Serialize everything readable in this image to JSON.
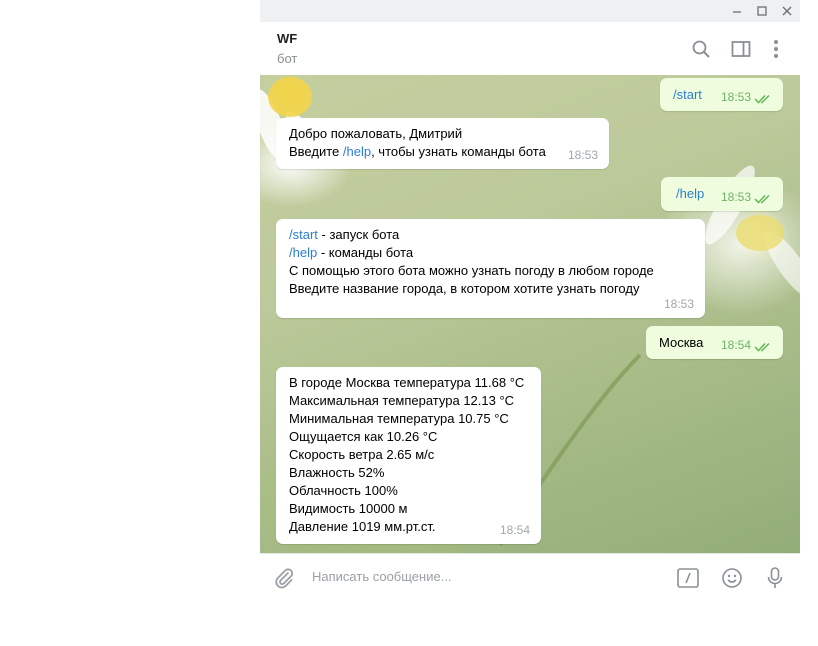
{
  "window": {
    "title": "",
    "minimize": "—",
    "maximize": "□",
    "close": "✕"
  },
  "header": {
    "title": "WF",
    "subtitle": "бот",
    "icons": [
      "search-icon",
      "sidebar-toggle-icon",
      "more-icon"
    ]
  },
  "messages": [
    {
      "dir": "out",
      "parts": [
        {
          "text": "/start",
          "cmd": true
        }
      ],
      "time": "18:53",
      "status": "read"
    },
    {
      "dir": "in",
      "lines": [
        [
          {
            "text": "Добро пожаловать, Дмитрий"
          }
        ],
        [
          {
            "text": "Введите "
          },
          {
            "text": "/help",
            "cmd": true
          },
          {
            "text": ", чтобы узнать команды бота"
          }
        ]
      ],
      "time": "18:53"
    },
    {
      "dir": "out",
      "parts": [
        {
          "text": "/help",
          "cmd": true
        }
      ],
      "time": "18:53",
      "status": "read"
    },
    {
      "dir": "in",
      "lines": [
        [
          {
            "text": "/start",
            "cmd": true
          },
          {
            "text": " - запуск бота"
          }
        ],
        [
          {
            "text": "/help",
            "cmd": true
          },
          {
            "text": " - команды бота"
          }
        ],
        [
          {
            "text": "С помощью этого бота можно узнать погоду в любом городе"
          }
        ],
        [
          {
            "text": "Введите название города, в котором хотите узнать погоду"
          }
        ]
      ],
      "time": "18:53"
    },
    {
      "dir": "out",
      "parts": [
        {
          "text": "Москва"
        }
      ],
      "time": "18:54",
      "status": "read"
    },
    {
      "dir": "in",
      "lines": [
        [
          {
            "text": "В городе Москва температура 11.68 °C"
          }
        ],
        [
          {
            "text": "Максимальная температура 12.13 °C"
          }
        ],
        [
          {
            "text": "Минимальная температура 10.75 °C"
          }
        ],
        [
          {
            "text": "Ощущается как 10.26 °C"
          }
        ],
        [
          {
            "text": "Скорость ветра 2.65 м/с"
          }
        ],
        [
          {
            "text": "Влажность 52%"
          }
        ],
        [
          {
            "text": "Облачность 100%"
          }
        ],
        [
          {
            "text": "Видимость 10000 м"
          }
        ],
        [
          {
            "text": "Давление 1019 мм.рт.ст."
          }
        ]
      ],
      "time": "18:54"
    }
  ],
  "composer": {
    "placeholder": "Написать сообщение...",
    "icons": [
      "paperclip-icon",
      "bot-commands-icon",
      "emoji-icon",
      "microphone-icon"
    ]
  },
  "colors": {
    "accent": "#2d7ed2",
    "outgoing_bubble": "#effdde",
    "read_tick": "#5fb85a"
  }
}
